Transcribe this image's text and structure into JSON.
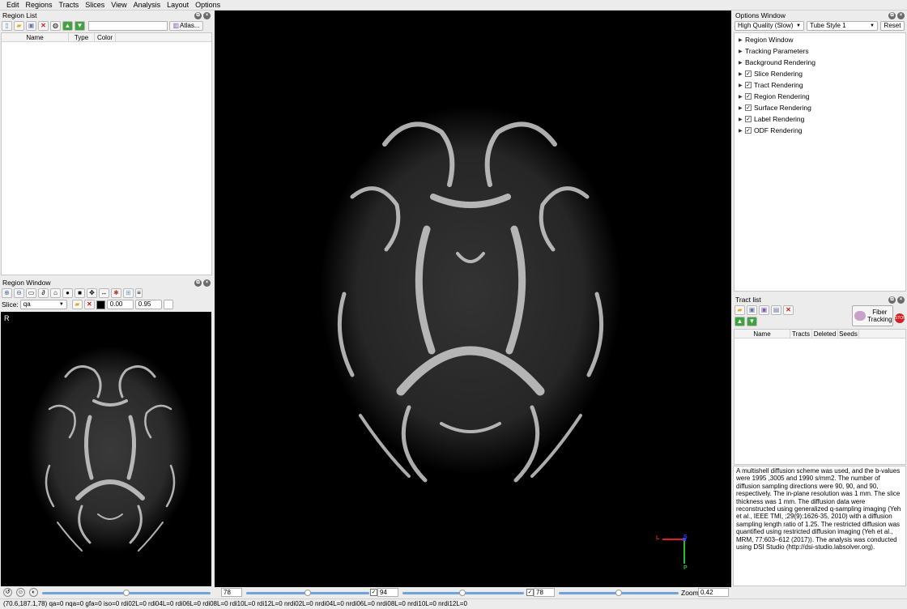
{
  "menubar": {
    "items": [
      "Edit",
      "Regions",
      "Tracts",
      "Slices",
      "View",
      "Analysis",
      "Layout",
      "Options"
    ]
  },
  "region_list": {
    "title": "Region List",
    "atlas_label": "Atlas...",
    "columns": [
      "Name",
      "Type",
      "Color"
    ]
  },
  "region_window": {
    "title": "Region Window",
    "slice_label": "Slice:",
    "slice_value": "qa",
    "min_value": "0.00",
    "max_value": "0.95",
    "orientation_label": "R"
  },
  "options_window": {
    "title": "Options Window",
    "quality_value": "High Quality (Slow)",
    "tube_style_value": "Tube Style 1",
    "reset_label": "Reset",
    "items": [
      {
        "label": "Region Window",
        "checked": false
      },
      {
        "label": "Tracking Parameters",
        "checked": false
      },
      {
        "label": "Background Rendering",
        "checked": false
      },
      {
        "label": "Slice Rendering",
        "checked": true
      },
      {
        "label": "Tract Rendering",
        "checked": true
      },
      {
        "label": "Region Rendering",
        "checked": true
      },
      {
        "label": "Surface Rendering",
        "checked": true
      },
      {
        "label": "Label Rendering",
        "checked": true
      },
      {
        "label": "ODF Rendering",
        "checked": true
      }
    ]
  },
  "tract_list": {
    "title": "Tract list",
    "fiber_tracking_label": "Fiber Tracking",
    "columns": [
      "Name",
      "Tracts",
      "Deleted",
      "Seeds"
    ]
  },
  "description": "A multishell diffusion scheme was used, and the b-values were 1995 ,3005 and 1990 s/mm2. The number of diffusion sampling directions were 90, 90, and 90, respectively. The in-plane resolution was 1 mm. The slice thickness was 1 mm. The diffusion data were reconstructed using generalized q-sampling imaging (Yeh et al., IEEE TMI, ;29(9):1626-35, 2010) with a diffusion sampling length ratio of 1.25. The restricted diffusion was quantified using restricted diffusion imaging (Yeh et al., MRM, 77:603–612 (2017)). The analysis was conducted using DSI Studio (http://dsi-studio.labsolver.org).",
  "axes": {
    "left": "L",
    "superior": "S",
    "posterior": "P",
    "left_color": "#e0211f",
    "superior_color": "#3344ff",
    "posterior_color": "#22c02a"
  },
  "slice_controls": {
    "sagittal_value": "78",
    "coronal_value": "94",
    "axial_value": "78",
    "zoom_label": "Zoom",
    "zoom_value": "0.42"
  },
  "status_bar": "(70.6,187.1,78)  qa=0 nqa=0 gfa=0 iso=0 rdi02L=0 rdi04L=0 rdi06L=0 rdi08L=0 rdi10L=0 rdi12L=0 nrdi02L=0 nrdi04L=0 nrdi06L=0 nrdi08L=0 nrdi10L=0 nrdi12L=0"
}
